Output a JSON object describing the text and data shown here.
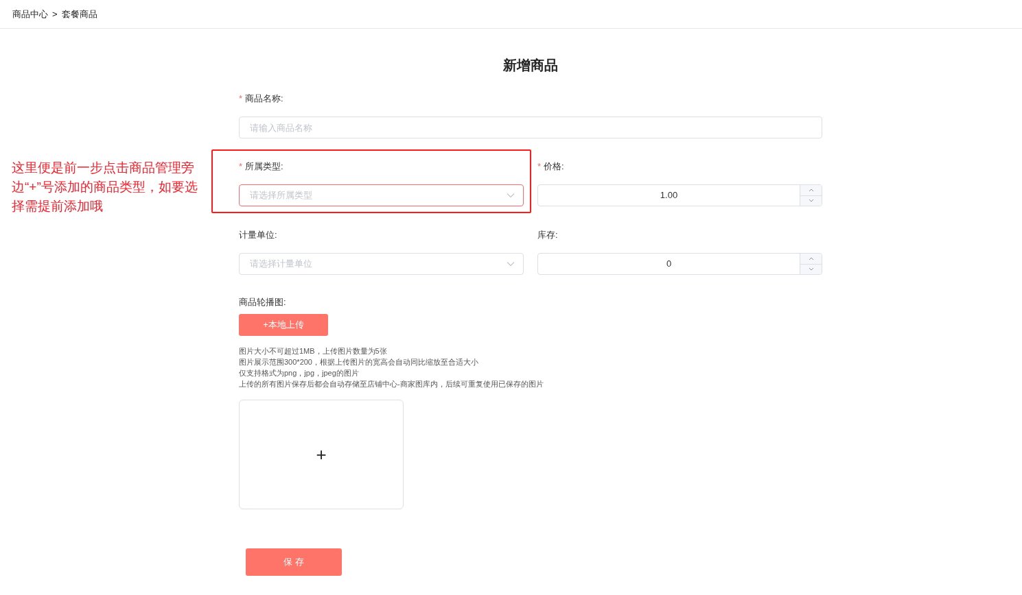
{
  "breadcrumb": {
    "items": [
      "商品中心",
      "套餐商品"
    ],
    "separator": ">"
  },
  "title": "新增商品",
  "rows": [
    {
      "fields": [
        {
          "kind": "text",
          "label": "商品名称:",
          "required_mark": "*",
          "placeholder": "请输入商品名称",
          "highlighted": false
        }
      ]
    },
    {
      "fields": [
        {
          "kind": "select",
          "label": "所属类型:",
          "required_mark": "*",
          "placeholder": "请选择所属类型",
          "highlighted": true
        },
        {
          "kind": "number",
          "label": "价格:",
          "required_mark": "*",
          "value": "1.00",
          "highlighted": false
        }
      ]
    },
    {
      "fields": [
        {
          "kind": "select",
          "label": "计量单位:",
          "placeholder": "请选择计量单位",
          "highlighted": false
        },
        {
          "kind": "number",
          "label": "库存:",
          "value": "0",
          "highlighted": false
        }
      ]
    }
  ],
  "upload": {
    "label": "商品轮播图:",
    "button": "+本地上传",
    "tips": [
      "图片大小不可超过1MB，上传图片数量为5张",
      "图片展示范围300*200，根据上传图片的宽高会自动同比缩放至合适大小",
      "仅支持格式为png，jpg，jpeg的图片",
      "上传的所有图片保存后都会自动存储至店铺中心-商家图库内，后续可重复使用已保存的图片"
    ],
    "add_symbol": "+"
  },
  "annotation": "这里便是前一步点击商品管理旁边“+”号添加的商品类型，如要选择需提前添加哦",
  "save_button": "保 存"
}
